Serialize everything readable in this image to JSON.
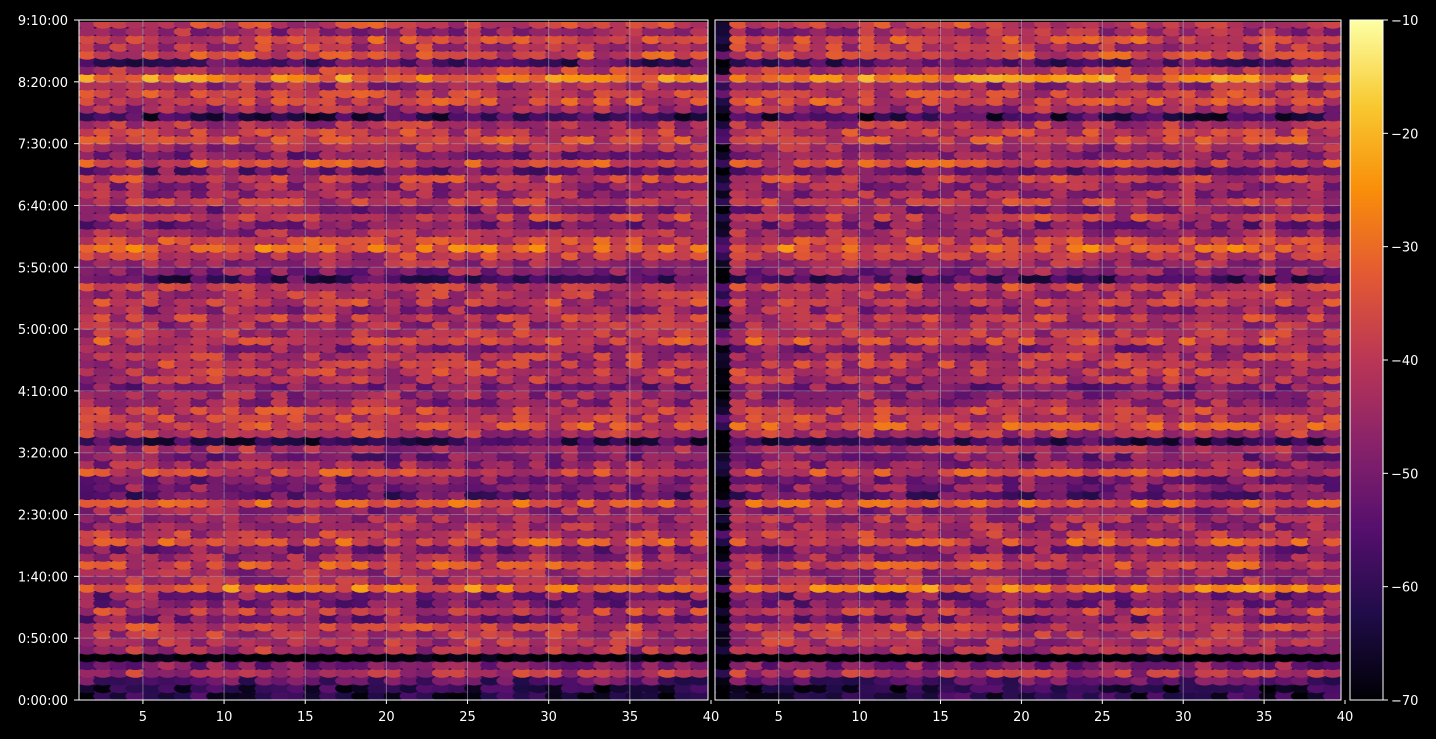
{
  "chart_data": {
    "type": "heatmap",
    "panels": 2,
    "shared_y_axis": true,
    "x": {
      "range": [
        1,
        40
      ],
      "ticks": [
        5,
        10,
        15,
        20,
        25,
        30,
        35,
        40
      ],
      "tick_labels": [
        "5",
        "10",
        "15",
        "20",
        "25",
        "30",
        "35",
        "40"
      ]
    },
    "y": {
      "range_seconds": [
        0,
        33000
      ],
      "ticks": [
        0,
        3000,
        6000,
        9000,
        12000,
        15000,
        18000,
        21000,
        24000,
        27000,
        30000,
        33000
      ],
      "tick_labels": [
        "0:00:00",
        "0:50:00",
        "1:40:00",
        "2:30:00",
        "3:20:00",
        "4:10:00",
        "5:00:00",
        "5:50:00",
        "6:40:00",
        "7:30:00",
        "8:20:00",
        "9:10:00"
      ]
    },
    "colorbar": {
      "colormap": "inferno",
      "range": [
        -70,
        -10
      ],
      "ticks": [
        -70,
        -60,
        -50,
        -40,
        -30,
        -20,
        -10
      ],
      "tick_labels": [
        "−70",
        "−60",
        "−50",
        "−40",
        "−30",
        "−20",
        "−10"
      ]
    },
    "grid": true,
    "colors": {
      "background": "#000000",
      "grid": "#b4b4b4",
      "text": "#ffffff"
    }
  }
}
